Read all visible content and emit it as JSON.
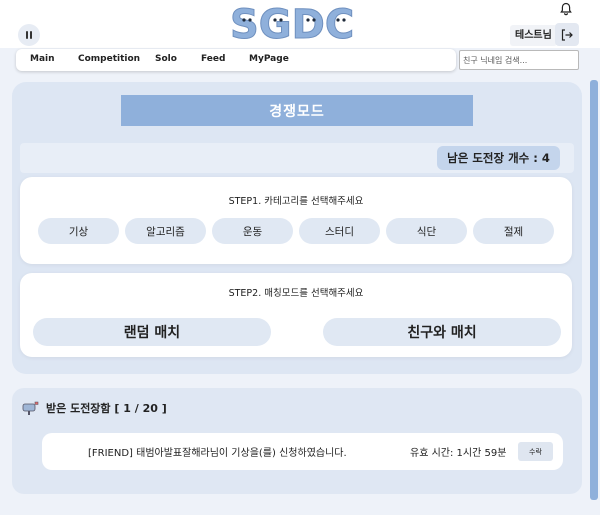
{
  "header": {
    "logo_text": "SGDC",
    "user_name": "테스트님",
    "icons": [
      "menu-icon",
      "bell-icon",
      "logout-icon"
    ]
  },
  "nav": {
    "items": [
      "Main",
      "Competition",
      "Solo",
      "Feed",
      "MyPage"
    ]
  },
  "search": {
    "placeholder": "친구 닉네임 검색..."
  },
  "competition": {
    "title": "경쟁모드",
    "remaining_label": "남은 도전장 개수 : 4",
    "step1": {
      "title": "STEP1. 카테고리를 선택해주세요",
      "categories": [
        "기상",
        "알고리즘",
        "운동",
        "스터디",
        "식단",
        "절제"
      ]
    },
    "step2": {
      "title": "STEP2. 매칭모드를 선택해주세요",
      "random_match": "랜덤 매치",
      "friend_match": "친구와 매치"
    }
  },
  "inbox": {
    "title": "받은 도전장함 [ 1 / 20 ]",
    "items": [
      {
        "message": "[FRIEND] 태범아발표잘해라님이 기상을(를) 신청하였습니다.",
        "expire": "유효 시간: 1시간 59분",
        "accept_label": "수락"
      }
    ]
  },
  "colors": {
    "accent": "#8fb0db",
    "panel": "#dde6f3",
    "button": "#e0e8f3",
    "logo": "#8fb0db"
  }
}
